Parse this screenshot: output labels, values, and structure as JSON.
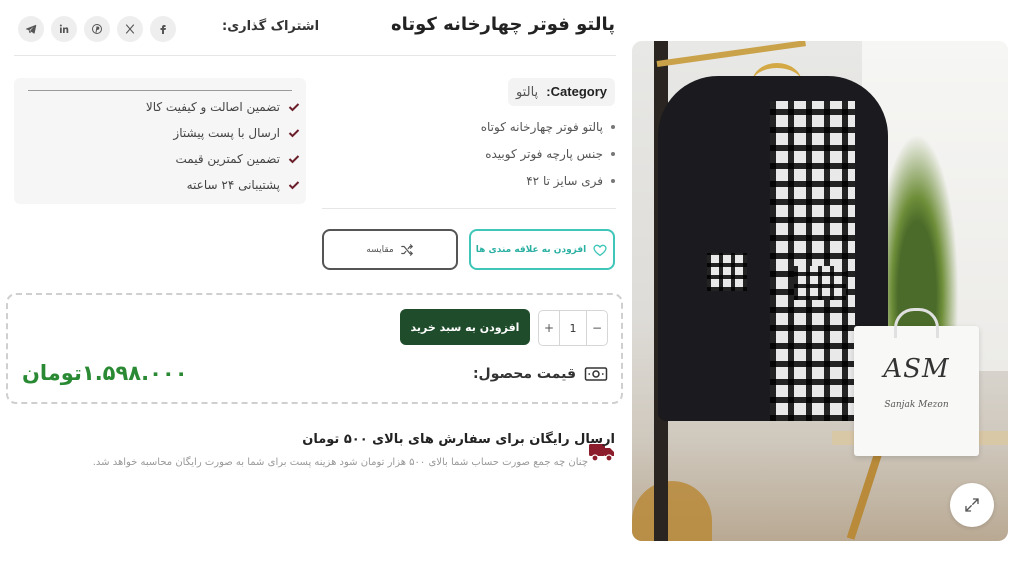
{
  "product": {
    "title": "پالتو فوتر چهارخانه کوتاه",
    "category_key": "Category:",
    "category_value": "پالتو",
    "bullets": [
      "پالتو فوتر چهارخانه کوتاه",
      "جنس پارچه فوتر کوبیده",
      "فری سایز تا ۴۲"
    ]
  },
  "share": {
    "label": "اشتراک گذاری:",
    "icons": [
      "facebook-icon",
      "x-icon",
      "pinterest-icon",
      "linkedin-icon",
      "telegram-icon"
    ]
  },
  "guarantees": [
    "تضمین اصالت و کیفیت کالا",
    "ارسال با پست پیشتاز",
    "تضمین کمترین قیمت",
    "پشتیبانی ۲۴ ساعته"
  ],
  "actions": {
    "wishlist_label": "افزودن به علاقه مندی ها",
    "compare_label": "مقایسه"
  },
  "purchase": {
    "quantity": "1",
    "minus": "−",
    "plus": "+",
    "add_to_cart_label": "افزودن به سبد خرید",
    "price_label": "قیمت محصول:",
    "price_value": "۱.۵۹۸.۰۰۰تومان"
  },
  "shipping": {
    "title": "ارسال رایگان برای سفارش های بالای ۵۰۰ تومان",
    "description": "چنان چه جمع صورت حساب شما بالای ۵۰۰ هزار تومان شود هزینه پست برای شما به صورت رایگان محاسبه خواهد شد."
  },
  "image": {
    "bag_logo": "ASM",
    "bag_subtitle": "Sanjak Mezon"
  },
  "colors": {
    "accent_green": "#1f4d2b",
    "price_green": "#2a8a34",
    "wishlist_teal": "#3fc6b8",
    "check_maroon": "#6b1f2a",
    "truck_red": "#8b1d2c"
  }
}
